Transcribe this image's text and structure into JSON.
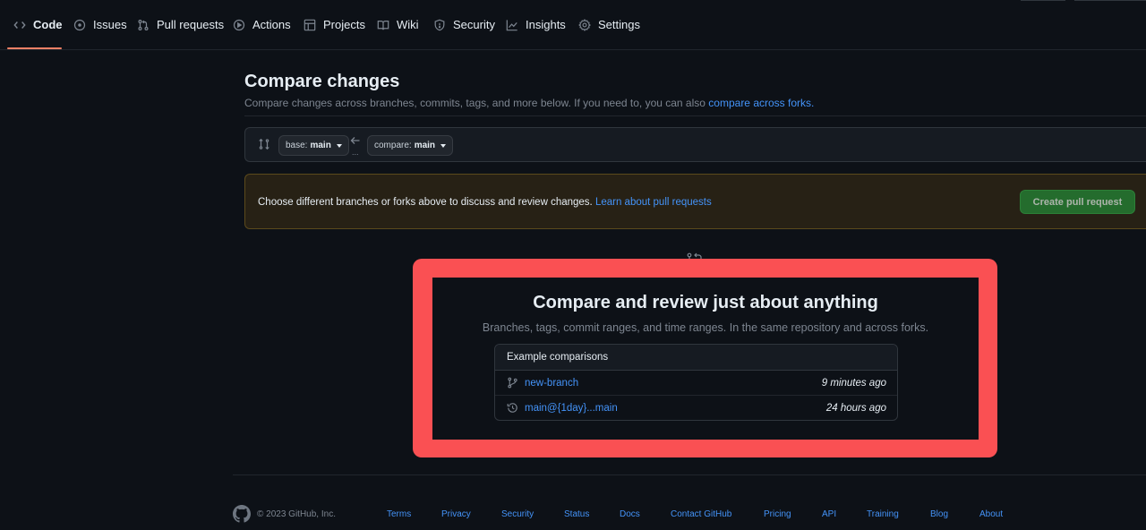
{
  "repo_nav": {
    "tabs": [
      {
        "label": "Code",
        "icon": "code-icon",
        "selected": true
      },
      {
        "label": "Issues",
        "icon": "issue-icon"
      },
      {
        "label": "Pull requests",
        "icon": "pull-request-icon"
      },
      {
        "label": "Actions",
        "icon": "play-icon"
      },
      {
        "label": "Projects",
        "icon": "table-icon"
      },
      {
        "label": "Wiki",
        "icon": "book-icon"
      },
      {
        "label": "Security",
        "icon": "shield-icon"
      },
      {
        "label": "Insights",
        "icon": "graph-icon"
      },
      {
        "label": "Settings",
        "icon": "gear-icon"
      }
    ]
  },
  "compare": {
    "title": "Compare changes",
    "subtitle": "Compare changes across branches, commits, tags, and more below. If you need to, you can also",
    "subtitle_link": "compare across forks.",
    "base_prefix": "base:",
    "base_branch": "main",
    "compare_prefix": "compare:",
    "compare_branch": "main",
    "dots": "..."
  },
  "flash": {
    "text": "Choose different branches or forks above to discuss and review changes.",
    "link": "Learn about pull requests",
    "button": "Create pull request"
  },
  "blankslate": {
    "title": "Compare and review just about anything",
    "subtitle": "Branches, tags, commit ranges, and time ranges. In the same repository and across forks.",
    "examples_header": "Example comparisons",
    "examples": [
      {
        "icon": "git-branch-icon",
        "label": "new-branch",
        "time": "9 minutes ago"
      },
      {
        "icon": "history-icon",
        "label": "main@{1day}...main",
        "time": "24 hours ago"
      }
    ]
  },
  "footer": {
    "copyright": "© 2023 GitHub, Inc.",
    "links": [
      "Terms",
      "Privacy",
      "Security",
      "Status",
      "Docs",
      "Contact GitHub",
      "Pricing",
      "API",
      "Training",
      "Blog",
      "About"
    ]
  },
  "colors": {
    "background": "#0d1117",
    "accent_link": "#4493f8",
    "selected_underline": "#f78166",
    "highlight": "#fa5053",
    "primary_button": "#238636"
  }
}
